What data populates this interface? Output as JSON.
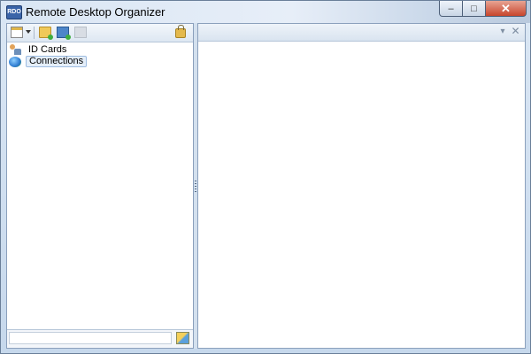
{
  "window": {
    "title": "Remote Desktop Organizer",
    "app_icon_text": "RDO",
    "minimize_glyph": "–",
    "maximize_glyph": "□",
    "close_glyph": "✕"
  },
  "left_toolbar": {
    "icons": [
      "new-item-icon",
      "dropdown-caret-icon",
      "new-folder-icon",
      "new-connection-icon",
      "disabled-action-icon",
      "lock-icon"
    ]
  },
  "tree": {
    "items": [
      {
        "label": "ID Cards",
        "icon": "id-cards-icon",
        "selected": false
      },
      {
        "label": "Connections",
        "icon": "connections-icon",
        "selected": true
      }
    ]
  },
  "filter": {
    "value": "",
    "go_icon": "apply-filter-icon"
  },
  "right_pane": {
    "menu_glyph": "▾",
    "close_glyph": "✕"
  }
}
